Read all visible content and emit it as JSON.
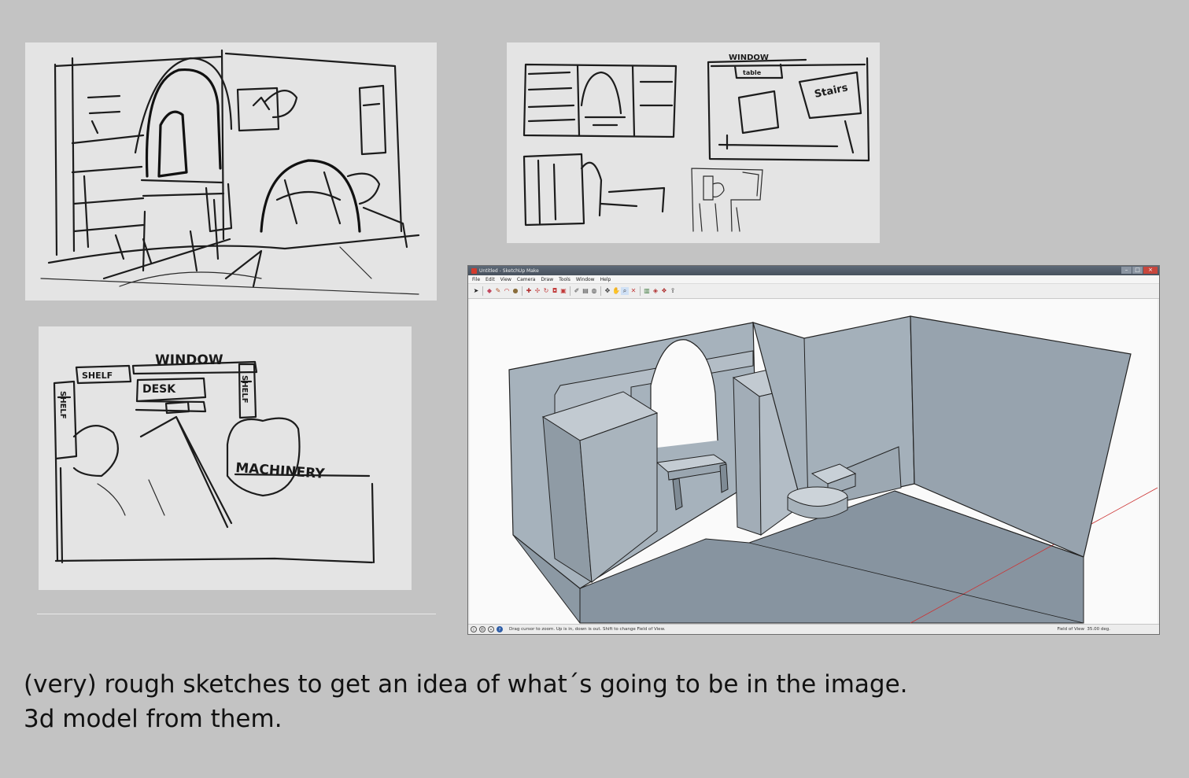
{
  "sketch_room_panel": {},
  "sketch_thumbnails_panel": {
    "label_window": "WINDOW",
    "label_table": "table",
    "label_stairs": "Stairs"
  },
  "floorplan_panel": {
    "label_window": "WINDOW",
    "label_shelf_top": "SHELF",
    "label_desk": "DESK",
    "label_shelf_left": "SHELF",
    "label_shelf_right": "SHELF",
    "label_machinery": "MACHINERY"
  },
  "sketchup": {
    "title": "Untitled - SketchUp Make",
    "menu": [
      "File",
      "Edit",
      "View",
      "Camera",
      "Draw",
      "Tools",
      "Window",
      "Help"
    ],
    "status_hint": "Drag cursor to zoom. Up is in, down is out. Shift to change Field of View.",
    "measure_label": "Field of View",
    "measure_value": "35.00 deg."
  },
  "caption": {
    "line1": "(very) rough sketches to get an idea of what´s going to be in the image.",
    "line2": "3d model from them."
  }
}
